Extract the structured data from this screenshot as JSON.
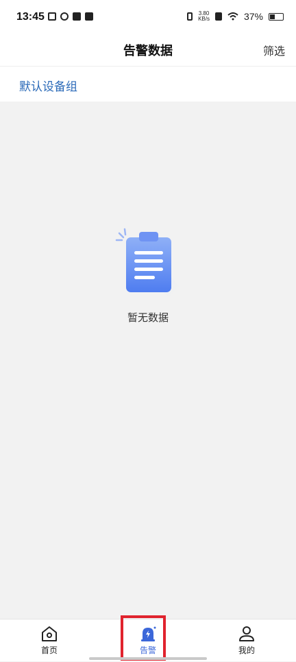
{
  "status_bar": {
    "time": "13:45",
    "speed_top": "3.80",
    "speed_bottom": "KB/s",
    "battery": "37%",
    "battery_level": 0.37
  },
  "header": {
    "title": "告警数据",
    "filter_label": "筛选"
  },
  "group": {
    "label": "默认设备组"
  },
  "empty": {
    "text": "暂无数据",
    "icon": "clipboard-icon"
  },
  "tabs": [
    {
      "label": "首页",
      "icon": "home-icon",
      "active": false
    },
    {
      "label": "告警",
      "icon": "alarm-icon",
      "active": true
    },
    {
      "label": "我的",
      "icon": "user-icon",
      "active": false
    }
  ],
  "colors": {
    "accent": "#3b67d9",
    "group_link": "#2b6ab8",
    "highlight": "#e0232e"
  }
}
